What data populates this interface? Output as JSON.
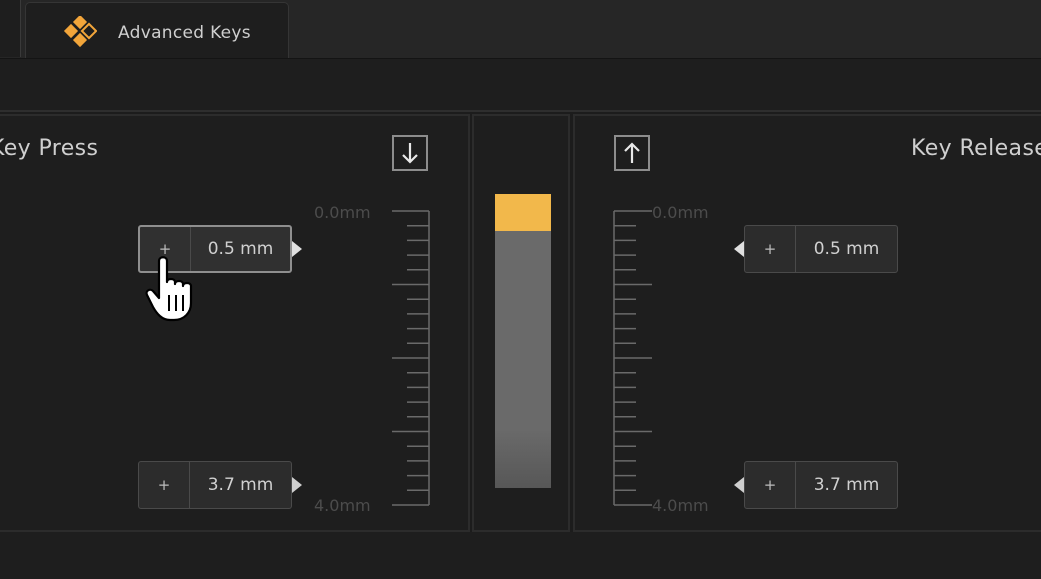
{
  "tabs": {
    "active_label": "Advanced Keys"
  },
  "key_press": {
    "title": "Key Press",
    "direction_icon": "arrow-down-icon",
    "scale_top": "0.0mm",
    "scale_bottom": "4.0mm",
    "actuation": {
      "plus": "+",
      "value": "0.5 mm"
    },
    "bottom_point": {
      "plus": "+",
      "value": "3.7 mm"
    }
  },
  "travel_meter": {
    "pressed_fraction": 0.125,
    "accent": "#f2b84b"
  },
  "key_release": {
    "title": "Key Release",
    "direction_icon": "arrow-up-icon",
    "scale_top": "0.0mm",
    "scale_bottom": "4.0mm",
    "release_point": {
      "plus": "+",
      "value": "0.5 mm"
    },
    "bottom_point": {
      "plus": "+",
      "value": "3.7 mm"
    }
  },
  "colors": {
    "accent": "#f2b84b",
    "background": "#1c1c1c",
    "panel": "#1e1e1e"
  }
}
